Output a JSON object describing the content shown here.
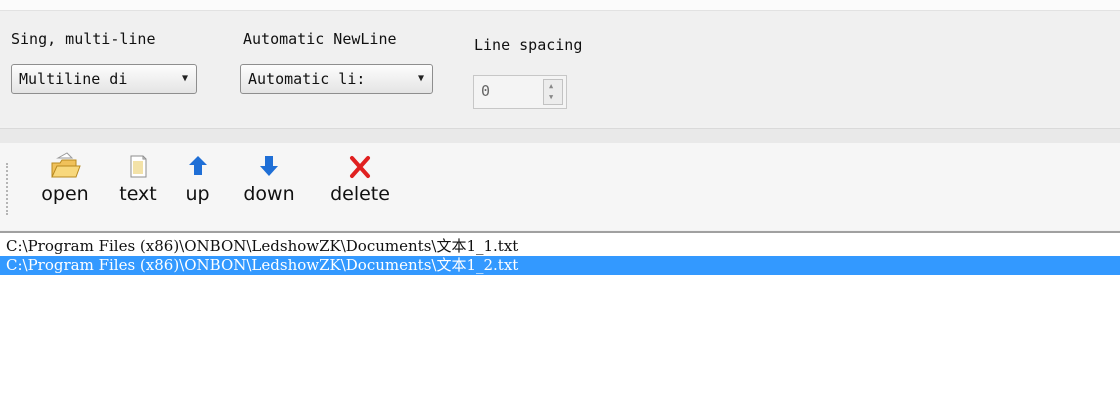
{
  "options": {
    "line_mode_label": "Sing, multi-line",
    "line_mode_value": "Multiline di",
    "newline_label": "Automatic NewLine",
    "newline_value": "Automatic li:",
    "spacing_label": "Line spacing",
    "spacing_value": "0"
  },
  "toolbar": {
    "open": "open",
    "text": "text",
    "up": "up",
    "down": "down",
    "delete": "delete"
  },
  "icons": {
    "open": "folder-open-icon",
    "text": "document-icon",
    "up": "arrow-up-icon",
    "down": "arrow-down-icon",
    "delete": "red-x-icon"
  },
  "colors": {
    "selection": "#3399ff",
    "arrows": "#1f6fd6",
    "delete": "#e02020"
  },
  "files": [
    "C:\\Program Files (x86)\\ONBON\\LedshowZK\\Documents\\文本1_1.txt",
    "C:\\Program Files (x86)\\ONBON\\LedshowZK\\Documents\\文本1_2.txt"
  ],
  "selected_index": 1
}
